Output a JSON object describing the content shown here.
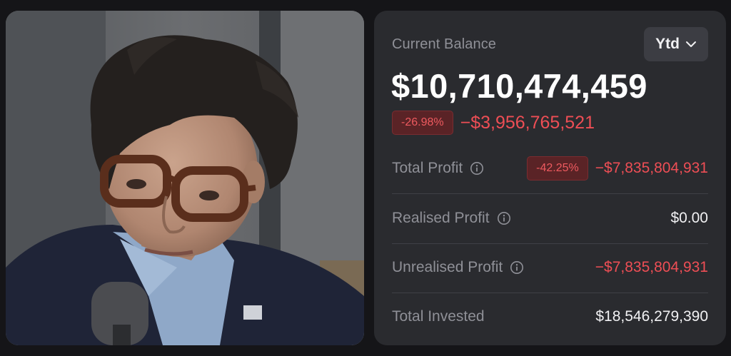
{
  "balance_card": {
    "label": "Current Balance",
    "period": "Ytd",
    "amount": "$10,710,474,459",
    "change_percent": "-26.98%",
    "change_amount": "−$3,956,765,521",
    "rows": [
      {
        "label": "Total Profit",
        "percent": "-42.25%",
        "value": "−$7,835,804,931",
        "info_icon": "info-icon"
      },
      {
        "label": "Realised Profit",
        "value": "$0.00",
        "info_icon": "info-icon"
      },
      {
        "label": "Unrealised Profit",
        "value": "−$7,835,804,931",
        "info_icon": "info-icon"
      },
      {
        "label": "Total Invested",
        "value": "$18,546,279,390"
      }
    ]
  },
  "colors": {
    "background": "#151518",
    "card": "#2a2b2f",
    "negative": "#ee4e55",
    "muted_text": "#8f9097",
    "primary_text": "#ffffff"
  }
}
